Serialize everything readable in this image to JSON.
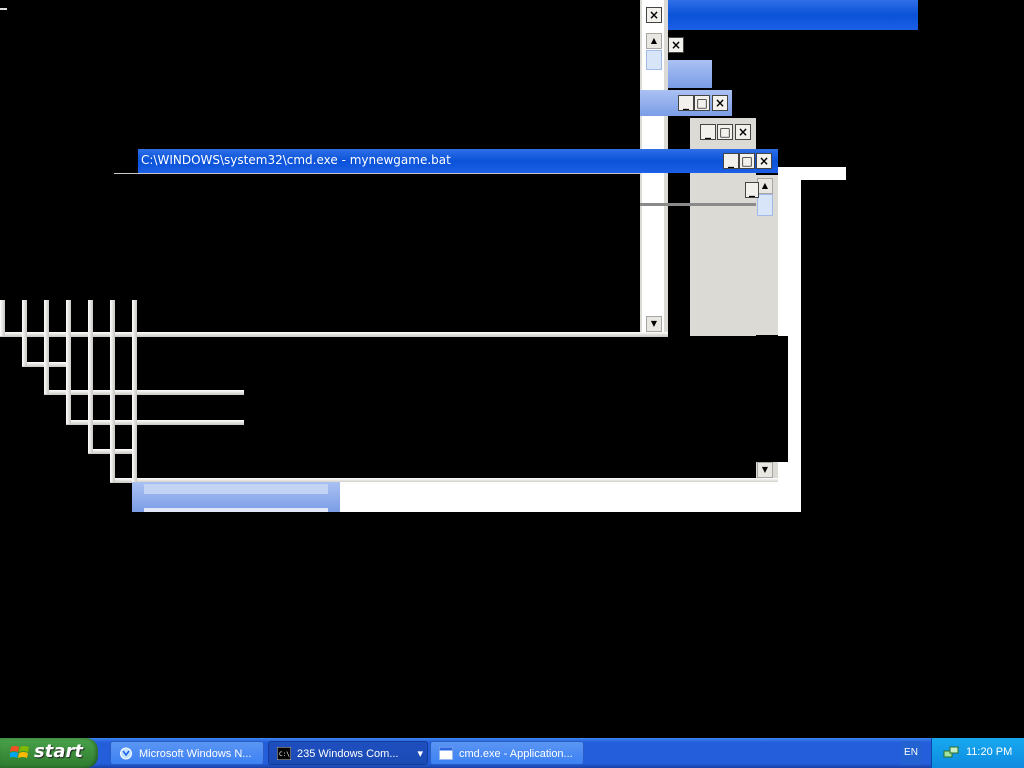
{
  "window": {
    "title": "C:\\WINDOWS\\system32\\cmd.exe - mynewgame.bat",
    "btn_minimize": "_",
    "btn_maximize": "□",
    "btn_close": "×"
  },
  "scroll": {
    "up": "▲",
    "down": "▼"
  },
  "taskbar": {
    "start_label": "start",
    "tasks": [
      {
        "label": "Microsoft Windows N...",
        "icon": "outlook-express-icon"
      },
      {
        "label": "235 Windows Com...",
        "icon": "cmd-icon",
        "dropdown": "▾"
      },
      {
        "label": "cmd.exe - Application...",
        "icon": "window-icon"
      }
    ],
    "lang": "EN",
    "clock": "11:20 PM"
  },
  "colors": {
    "titlebar": "#0a52d8",
    "taskbar": "#245edb",
    "start": "#3c8e3c",
    "tray": "#0e8be0"
  }
}
